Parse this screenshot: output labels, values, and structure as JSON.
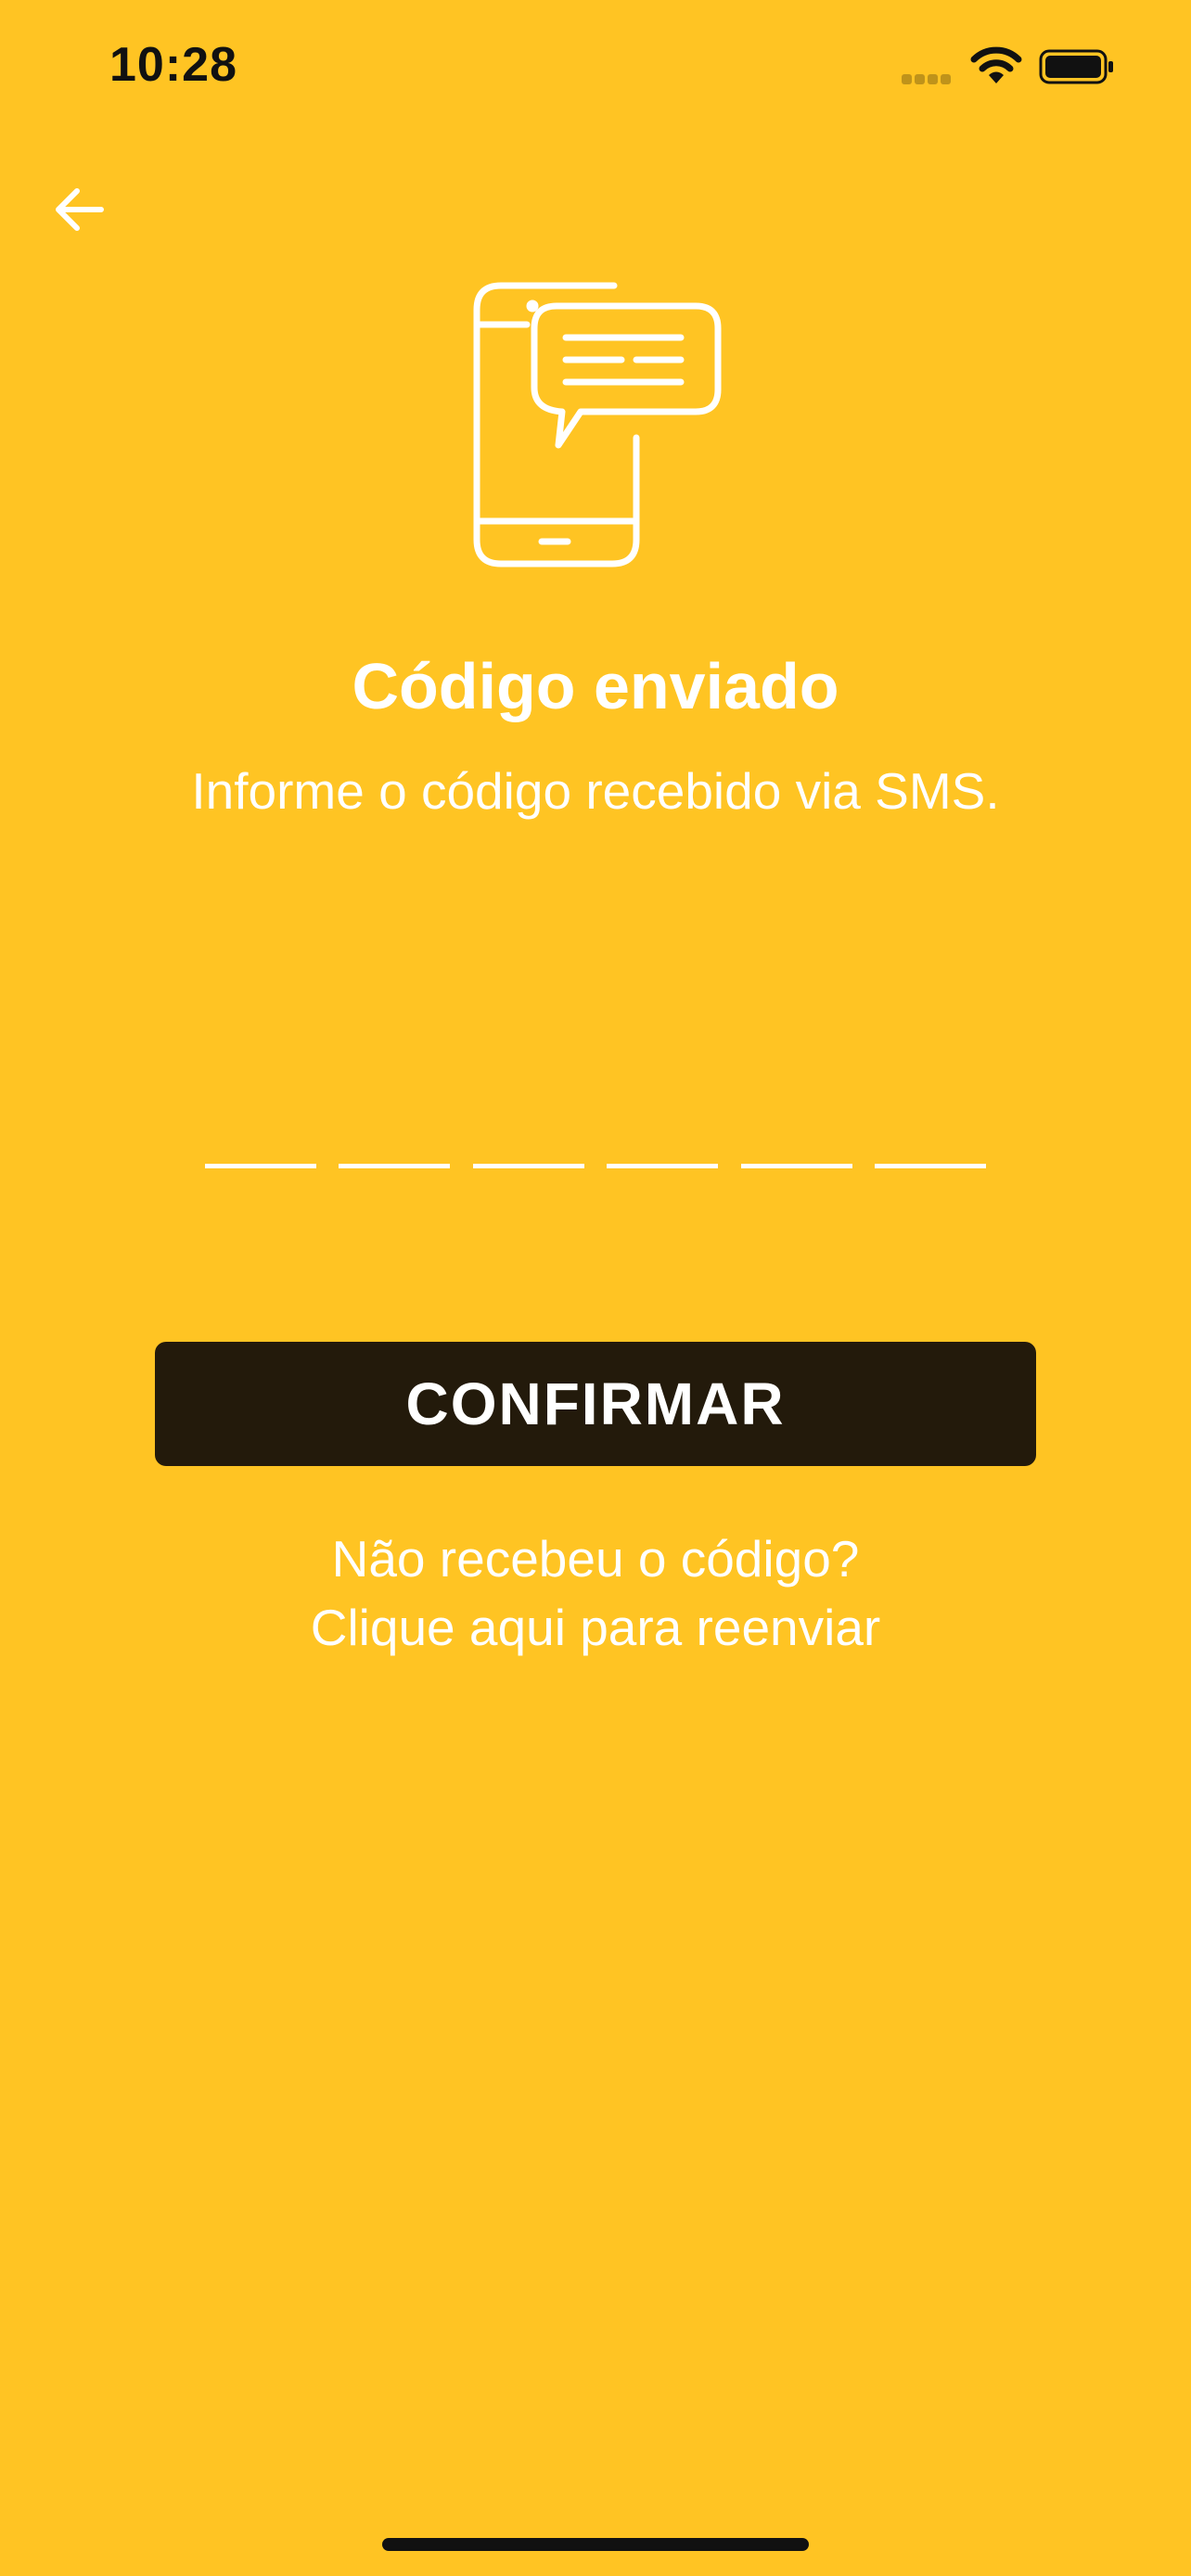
{
  "status_bar": {
    "time": "10:28"
  },
  "header": {
    "back_icon": "arrow-left-icon"
  },
  "illustration": {
    "icon": "phone-sms-icon"
  },
  "main": {
    "title": "Código enviado",
    "subtitle": "Informe o código recebido via SMS.",
    "code_digits": [
      "",
      "",
      "",
      "",
      "",
      ""
    ],
    "confirm_label": "CONFIRMAR",
    "resend_line1": "Não recebeu o código?",
    "resend_line2": "Clique aqui para reenviar"
  },
  "colors": {
    "background": "#FFC423",
    "button": "#231A0B",
    "text": "#FFFFFF"
  }
}
